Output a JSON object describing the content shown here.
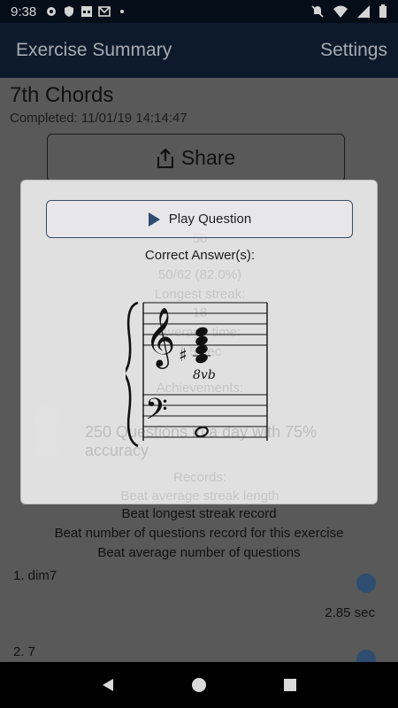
{
  "status_bar": {
    "time": "9:38"
  },
  "app_bar": {
    "title": "Exercise Summary",
    "settings_label": "Settings"
  },
  "summary": {
    "exercise_title": "7th Chords",
    "completed": "Completed: 11/01/19 14:14:47",
    "share_label": "Share",
    "records": [
      "Beat longest streak record",
      "Beat number of questions record for this exercise",
      "Beat average number of questions"
    ],
    "list": [
      {
        "label": "1. dim7",
        "time": "2.85 sec"
      },
      {
        "label": "2. 7"
      }
    ]
  },
  "dialog": {
    "play_label": "Play Question",
    "correct_answers_label": "Correct Answer(s):",
    "octave_marking": "8vb",
    "background_text": {
      "questions": "50",
      "correct": "50/62 (82.0%)",
      "longest_streak_label": "Longest streak:",
      "longest_streak": "18",
      "average_time_label": "Average time:",
      "average_time": "1.5 sec",
      "achievements_label": "Achievements:",
      "achievement": "250 Questions in a day with 75% accuracy",
      "records_label": "Records:",
      "record_avg_streak": "Beat average streak length"
    }
  },
  "colors": {
    "app_bar": "#0d1a2b",
    "accent": "#2e4d6f",
    "dialog_bg": "#eeeef0"
  }
}
